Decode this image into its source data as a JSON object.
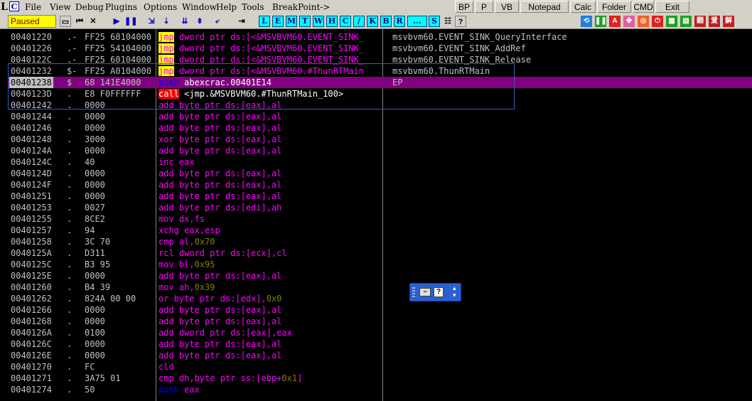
{
  "menu": {
    "app_letter": "C",
    "left_letter": "L",
    "items": [
      "File",
      "View",
      "Debug",
      "Plugins",
      "Options",
      "Window",
      "Help",
      "Tools",
      "BreakPoint->"
    ]
  },
  "buttons": [
    "BP",
    "P",
    "VB",
    "Notepad",
    "Calc",
    "Folder",
    "CMD",
    "Exit"
  ],
  "status": "Paused",
  "toolbar": {
    "letter_buttons": [
      "L",
      "E",
      "M",
      "T",
      "W",
      "H",
      "C",
      "/",
      "K",
      "B",
      "R",
      "...",
      "S"
    ],
    "help": "?",
    "right_icons": [
      "翻",
      "爱",
      "解"
    ]
  },
  "rows": [
    {
      "addr": "00401220",
      "mark": ".-",
      "hex": "FF25 68104000",
      "dis": [
        [
          "jmp",
          "mn-jmp"
        ],
        [
          " dword ptr ds:[<&MSVBVM60.EVENT_SINK_",
          "op"
        ]
      ],
      "cmt": "msvbvm60.EVENT_SINK_QueryInterface"
    },
    {
      "addr": "00401226",
      "mark": ".-",
      "hex": "FF25 54104000",
      "dis": [
        [
          "jmp",
          "mn-jmp"
        ],
        [
          " dword ptr ds:[<&MSVBVM60.EVENT_SINK_",
          "op"
        ]
      ],
      "cmt": "msvbvm60.EVENT_SINK_AddRef"
    },
    {
      "addr": "0040122C",
      "mark": ".-",
      "hex": "FF25 60104000",
      "dis": [
        [
          "jmp",
          "mn-jmp"
        ],
        [
          " dword ptr ds:[<&MSVBVM60.EVENT_SINK_",
          "op"
        ]
      ],
      "cmt": "msvbvm60.EVENT_SINK_Release"
    },
    {
      "addr": "00401232",
      "mark": "$-",
      "hex": "FF25 A0104000",
      "dis": [
        [
          "jmp",
          "mn-jmp"
        ],
        [
          " dword ptr ds:[<&MSVBVM60.#ThunRTMain",
          "op"
        ]
      ],
      "cmt": "msvbvm60.ThunRTMain"
    },
    {
      "addr": "00401238",
      "mark": "$",
      "hex": "68 141E4000",
      "dis": [
        [
          "push",
          "mn-push"
        ],
        [
          " abexcrac.00401E14",
          "op-w"
        ]
      ],
      "cmt": "EP",
      "selected": true
    },
    {
      "addr": "0040123D",
      "mark": ".",
      "hex": "E8 F0FFFFFF",
      "dis": [
        [
          "call",
          "mn-call"
        ],
        [
          " <jmp.&MSVBVM60.#ThunRTMain_100>",
          "op-w"
        ]
      ],
      "cmt": ""
    },
    {
      "addr": "00401242",
      "mark": ".",
      "hex": "0000",
      "dis": [
        [
          "add",
          "mn-y"
        ],
        [
          " byte ptr ds:[eax],al",
          "op"
        ]
      ],
      "cmt": ""
    },
    {
      "addr": "00401244",
      "mark": ".",
      "hex": "0000",
      "dis": [
        [
          "add",
          "mn-y"
        ],
        [
          " byte ptr ds:[eax],al",
          "op"
        ]
      ],
      "cmt": ""
    },
    {
      "addr": "00401246",
      "mark": ".",
      "hex": "0000",
      "dis": [
        [
          "add",
          "mn-y"
        ],
        [
          " byte ptr ds:[eax],al",
          "op"
        ]
      ],
      "cmt": ""
    },
    {
      "addr": "00401248",
      "mark": ".",
      "hex": "3000",
      "dis": [
        [
          "xor",
          "mn-y"
        ],
        [
          " byte ptr ds:[eax],al",
          "op"
        ]
      ],
      "cmt": ""
    },
    {
      "addr": "0040124A",
      "mark": ".",
      "hex": "0000",
      "dis": [
        [
          "add",
          "mn-y"
        ],
        [
          " byte ptr ds:[eax],al",
          "op"
        ]
      ],
      "cmt": ""
    },
    {
      "addr": "0040124C",
      "mark": ".",
      "hex": "40",
      "dis": [
        [
          "inc",
          "mn-inc"
        ],
        [
          " eax",
          "op"
        ]
      ],
      "cmt": ""
    },
    {
      "addr": "0040124D",
      "mark": ".",
      "hex": "0000",
      "dis": [
        [
          "add",
          "mn-y"
        ],
        [
          " byte ptr ds:[eax],al",
          "op"
        ]
      ],
      "cmt": ""
    },
    {
      "addr": "0040124F",
      "mark": ".",
      "hex": "0000",
      "dis": [
        [
          "add",
          "mn-y"
        ],
        [
          " byte ptr ds:[eax],al",
          "op"
        ]
      ],
      "cmt": ""
    },
    {
      "addr": "00401251",
      "mark": ".",
      "hex": "0000",
      "dis": [
        [
          "add",
          "mn-y"
        ],
        [
          " byte ptr ds:[eax],al",
          "op"
        ]
      ],
      "cmt": ""
    },
    {
      "addr": "00401253",
      "mark": ".",
      "hex": "0027",
      "dis": [
        [
          "add",
          "mn-y"
        ],
        [
          " byte ptr ds:[edi],ah",
          "op"
        ]
      ],
      "cmt": ""
    },
    {
      "addr": "00401255",
      "mark": ".",
      "hex": "8CE2",
      "dis": [
        [
          "mov",
          "mn-y"
        ],
        [
          " dx,fs",
          "op"
        ]
      ],
      "cmt": ""
    },
    {
      "addr": "00401257",
      "mark": ".",
      "hex": "94",
      "dis": [
        [
          "xchg",
          "mn-y"
        ],
        [
          " eax,esp",
          "op"
        ]
      ],
      "cmt": ""
    },
    {
      "addr": "00401258",
      "mark": ".",
      "hex": "3C 70",
      "dis": [
        [
          "cmp",
          "mn-y"
        ],
        [
          " al,",
          "op"
        ],
        [
          "0x70",
          "num"
        ]
      ],
      "cmt": ""
    },
    {
      "addr": "0040125A",
      "mark": ".",
      "hex": "D311",
      "dis": [
        [
          "rcl",
          "mn-y"
        ],
        [
          " dword ptr ds:[ecx],cl",
          "op"
        ]
      ],
      "cmt": ""
    },
    {
      "addr": "0040125C",
      "mark": ".",
      "hex": "B3 95",
      "dis": [
        [
          "mov",
          "mn-y"
        ],
        [
          " bl,",
          "op"
        ],
        [
          "0x95",
          "num"
        ]
      ],
      "cmt": ""
    },
    {
      "addr": "0040125E",
      "mark": ".",
      "hex": "0000",
      "dis": [
        [
          "add",
          "mn-y"
        ],
        [
          " byte ptr ds:[eax],al",
          "op"
        ]
      ],
      "cmt": ""
    },
    {
      "addr": "00401260",
      "mark": ".",
      "hex": "B4 39",
      "dis": [
        [
          "mov",
          "mn-y"
        ],
        [
          " ah,",
          "op"
        ],
        [
          "0x39",
          "num"
        ]
      ],
      "cmt": ""
    },
    {
      "addr": "00401262",
      "mark": ".",
      "hex": "824A 00 00",
      "dis": [
        [
          "or",
          "mn-y"
        ],
        [
          " byte ptr ds:[edx],",
          "op"
        ],
        [
          "0x0",
          "num"
        ]
      ],
      "cmt": ""
    },
    {
      "addr": "00401266",
      "mark": ".",
      "hex": "0000",
      "dis": [
        [
          "add",
          "mn-y"
        ],
        [
          " byte ptr ds:[eax],al",
          "op"
        ]
      ],
      "cmt": ""
    },
    {
      "addr": "00401268",
      "mark": ".",
      "hex": "0000",
      "dis": [
        [
          "add",
          "mn-y"
        ],
        [
          " byte ptr ds:[eax],al",
          "op"
        ]
      ],
      "cmt": ""
    },
    {
      "addr": "0040126A",
      "mark": ".",
      "hex": "0100",
      "dis": [
        [
          "add",
          "mn-y"
        ],
        [
          " dword ptr ds:[eax],eax",
          "op"
        ]
      ],
      "cmt": ""
    },
    {
      "addr": "0040126C",
      "mark": ".",
      "hex": "0000",
      "dis": [
        [
          "add",
          "mn-y"
        ],
        [
          " byte ptr ds:[eax],al",
          "op"
        ]
      ],
      "cmt": ""
    },
    {
      "addr": "0040126E",
      "mark": ".",
      "hex": "0000",
      "dis": [
        [
          "add",
          "mn-y"
        ],
        [
          " byte ptr ds:[eax],al",
          "op"
        ]
      ],
      "cmt": ""
    },
    {
      "addr": "00401270",
      "mark": ".",
      "hex": "FC",
      "dis": [
        [
          "cld",
          "mn-y"
        ]
      ],
      "cmt": ""
    },
    {
      "addr": "00401271",
      "mark": ".",
      "hex": "3A75 01",
      "dis": [
        [
          "cmp",
          "mn-y"
        ],
        [
          " dh,byte ptr ss:[ebp+",
          "op"
        ],
        [
          "0x1",
          "num"
        ],
        [
          "]",
          "op"
        ]
      ],
      "cmt": ""
    },
    {
      "addr": "00401274",
      "mark": ".",
      "hex": "50",
      "dis": [
        [
          "push",
          "mn-push"
        ],
        [
          " eax",
          "op"
        ]
      ],
      "cmt": ""
    }
  ],
  "colors": {
    "background": "#000000",
    "selected_row": "#800080",
    "status_bg": "#ffff00",
    "letter_button_bg": "#00ffff"
  }
}
